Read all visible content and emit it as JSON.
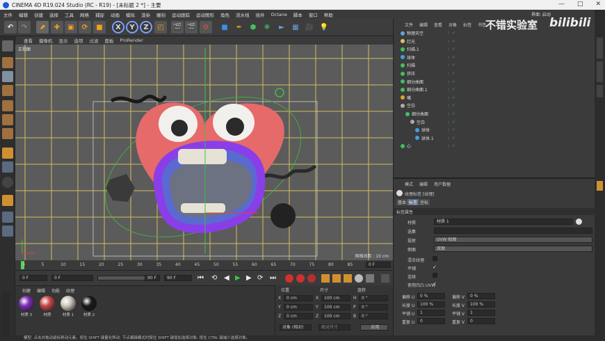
{
  "window": {
    "title": "CINEMA 4D R19.024 Studio (RC - R19) - [未标题 2 *] - 主要"
  },
  "menus": [
    "文件",
    "编辑",
    "创建",
    "选择",
    "工具",
    "网格",
    "捕捉",
    "动画",
    "模拟",
    "渲染",
    "雕刻",
    "运动跟踪",
    "运动图形",
    "角色",
    "流水线",
    "插件",
    "Octane",
    "脚本",
    "窗口",
    "帮助"
  ],
  "layout_label": "界面: 启动",
  "toolbar": {
    "x_label": "X",
    "y_label": "Y",
    "z_label": "Z"
  },
  "viewport": {
    "menu": [
      "查看",
      "摄像机",
      "显示",
      "选项",
      "过滤",
      "面板",
      "ProRender"
    ],
    "name": "正视图",
    "grid_distance": "网格间距 : 10 cm"
  },
  "timeline": {
    "ticks": [
      "0",
      "5",
      "10",
      "15",
      "20",
      "25",
      "30",
      "35",
      "40",
      "45",
      "50",
      "55",
      "60",
      "65",
      "70",
      "75",
      "80",
      "85",
      "90"
    ],
    "frame": "0 F"
  },
  "transport": {
    "start": "0 F",
    "current": "0 F",
    "end": "90 F",
    "end2": "90 F"
  },
  "materials": {
    "menu": [
      "创建",
      "编辑",
      "功能",
      "纹理"
    ],
    "items": [
      {
        "name": "材质 3",
        "color": "#7d2fb8"
      },
      {
        "name": "材质",
        "color": "#c94a4a"
      },
      {
        "name": "材质 1",
        "color": "#cfc8bd"
      },
      {
        "name": "材质 2",
        "color": "#1a1a1a"
      }
    ]
  },
  "coords": {
    "headers": [
      "位置",
      "尺寸",
      "旋转"
    ],
    "rows": [
      {
        "a": "X",
        "av": "0 cm",
        "b": "X",
        "bv": "100 cm",
        "c": "H",
        "cv": "0 °"
      },
      {
        "a": "Y",
        "av": "0 cm",
        "b": "Y",
        "bv": "100 cm",
        "c": "P",
        "cv": "0 °"
      },
      {
        "a": "Z",
        "av": "0 cm",
        "b": "Z",
        "bv": "100 cm",
        "c": "B",
        "cv": "0 °"
      }
    ],
    "mode": "对象 (相对)",
    "size_mode": "绝对尺寸",
    "apply": "应用"
  },
  "objects": {
    "menu": [
      "文件",
      "编辑",
      "查看",
      "对象",
      "标签",
      "书签"
    ],
    "watermark": "不错实验室",
    "brand": "bilibili",
    "rows": [
      {
        "name": "物理天空",
        "indent": 0,
        "color": "#6aa0e0"
      },
      {
        "name": "灯光",
        "indent": 0,
        "color": "#e0c060"
      },
      {
        "name": "扫描.1",
        "indent": 0,
        "color": "#40c060"
      },
      {
        "name": "球体",
        "indent": 0,
        "color": "#40a0e0"
      },
      {
        "name": "扫描",
        "indent": 0,
        "color": "#40c060"
      },
      {
        "name": "挤压",
        "indent": 0,
        "color": "#40c060"
      },
      {
        "name": "细分曲面",
        "indent": 0,
        "color": "#40c060"
      },
      {
        "name": "细分曲面.1",
        "indent": 0,
        "color": "#40c060"
      },
      {
        "name": "嘴",
        "indent": 0,
        "color": "#e0a030"
      },
      {
        "name": "空白",
        "indent": 0,
        "color": "#aaaaaa"
      },
      {
        "name": "细分曲面",
        "indent": 1,
        "color": "#40c060"
      },
      {
        "name": "空白",
        "indent": 2,
        "color": "#aaaaaa"
      },
      {
        "name": "球体",
        "indent": 3,
        "color": "#40a0e0"
      },
      {
        "name": "球体.1",
        "indent": 3,
        "color": "#40a0e0"
      },
      {
        "name": "心",
        "indent": 0,
        "color": "#40c060"
      }
    ]
  },
  "attributes": {
    "menu": [
      "模式",
      "编辑",
      "用户数据"
    ],
    "title": "纹理标签 [纹理]",
    "tabs": [
      "基本",
      "标签",
      "坐标"
    ],
    "section": "标签属性",
    "material_label": "材质",
    "material_value": "材质 1",
    "selection_label": "选集",
    "projection_label": "投射",
    "projection_value": "UVW 贴图",
    "side_label": "侧面",
    "side_value": "双面",
    "mix_label": "混合纹理",
    "tile_label": "平铺",
    "seamless_label": "连续",
    "uvw_label": "使用凹凸 UVW",
    "offset_u_label": "偏移 U",
    "offset_u": "0 %",
    "offset_v_label": "偏移 V",
    "offset_v": "0 %",
    "length_u_label": "长度 U",
    "length_u": "100 %",
    "length_v_label": "长度 V",
    "length_v": "100 %",
    "tiles_u_label": "平铺 U",
    "tiles_u": "1",
    "tiles_v_label": "平铺 V",
    "tiles_v": "1",
    "repeat_u_label": "重复 U",
    "repeat_u": "0",
    "repeat_v_label": "重复 V",
    "repeat_v": "0"
  },
  "status": "模型: 点击并拖动鼠标移动元素。按住 SHIFT 键量化移动; 节点编辑模式时按住 SHIFT 键增加选择对象; 按住 CTRL 键减少选择对象。",
  "colors": {
    "accent": "#f0a020",
    "grid": "#e8d060",
    "heart": "#e66a6a",
    "mouth": "#7a3ee0"
  }
}
